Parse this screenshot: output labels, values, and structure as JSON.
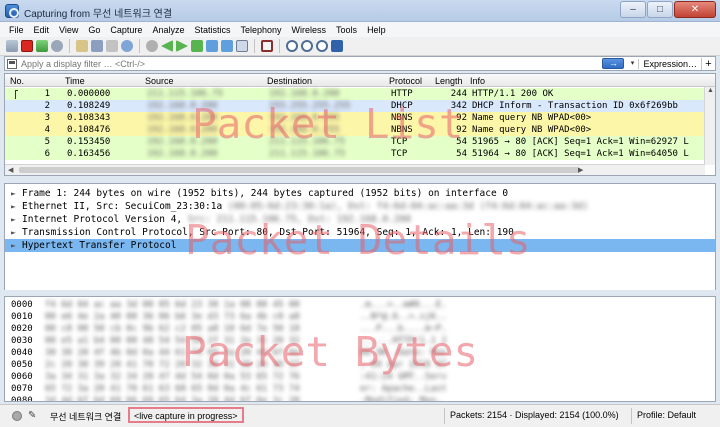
{
  "window": {
    "title": "Capturing from 무선 네트워크 연결",
    "minimize_icon": "minimize-icon",
    "maximize_icon": "maximize-icon",
    "close_icon": "close-icon"
  },
  "menu": [
    "File",
    "Edit",
    "View",
    "Go",
    "Capture",
    "Analyze",
    "Statistics",
    "Telephony",
    "Wireless",
    "Tools",
    "Help"
  ],
  "toolbar": {
    "icons": [
      "shark-fin-start-icon",
      "stop-capture-icon",
      "restart-capture-icon",
      "capture-options-icon",
      "open-file-icon",
      "save-file-icon",
      "close-file-icon",
      "reload-file-icon",
      "find-packet-icon",
      "go-back-icon",
      "go-forward-icon",
      "go-to-packet-icon",
      "go-first-icon",
      "go-last-icon",
      "autoscroll-icon",
      "colorize-icon",
      "zoom-in-icon",
      "zoom-out-icon",
      "zoom-normal-icon",
      "resize-columns-icon"
    ]
  },
  "filter": {
    "placeholder": "Apply a display filter … <Ctrl-/>",
    "arrow_label": "→",
    "dropdown_label": "▾",
    "expression_label": "Expression…",
    "plus_label": "+"
  },
  "packet_list": {
    "columns": [
      "No.",
      "Time",
      "Source",
      "Destination",
      "Protocol",
      "Length",
      "Info"
    ],
    "rows": [
      {
        "no": "1",
        "time": "0.000000",
        "source": "211.115.106.75",
        "destination": "192.168.0.200",
        "protocol": "HTTP",
        "length": "244",
        "info": "HTTP/1.1 200 OK",
        "bg": "#e4ffc7"
      },
      {
        "no": "2",
        "time": "0.108249",
        "source": "192.168.0.200",
        "destination": "255.255.255.255",
        "protocol": "DHCP",
        "length": "342",
        "info": "DHCP Inform   - Transaction ID 0x6f269bb",
        "bg": "#dae8fc"
      },
      {
        "no": "3",
        "time": "0.108343",
        "source": "192.168.0.200",
        "destination": "192.168.0.255",
        "protocol": "NBNS",
        "length": "92",
        "info": "Name query NB WPAD<00>",
        "bg": "#fcf6a8"
      },
      {
        "no": "4",
        "time": "0.108476",
        "source": "192.168.0.200",
        "destination": "192.168.0.255",
        "protocol": "NBNS",
        "length": "92",
        "info": "Name query NB WPAD<00>",
        "bg": "#fcf6a8"
      },
      {
        "no": "5",
        "time": "0.153450",
        "source": "192.168.0.200",
        "destination": "211.115.106.75",
        "protocol": "TCP",
        "length": "54",
        "info": "51965 → 80 [ACK] Seq=1 Ack=1 Win=62927 L",
        "bg": "#e4ffc7"
      },
      {
        "no": "6",
        "time": "0.163456",
        "source": "192.168.0.200",
        "destination": "211.115.106.75",
        "protocol": "TCP",
        "length": "54",
        "info": "51964 → 80 [ACK] Seq=1 Ack=1 Win=64050 L",
        "bg": "#e4ffc7"
      }
    ]
  },
  "packet_details": [
    {
      "text": "Frame 1: 244 bytes on wire (1952 bits), 244 bytes captured (1952 bits) on interface 0",
      "selected": false
    },
    {
      "text": "Ethernet II, Src: SecuiCom_23:30:1a",
      "blurred_tail": "(00:05:6d:23:30:1a), Dst: f4:6d:04:ac:aa:3d (f4:6d:04:ac:aa:3d)",
      "selected": false
    },
    {
      "text": "Internet Protocol Version 4,",
      "blurred_tail": "Src: 211.115.106.75, Dst: 192.168.0.200",
      "selected": false
    },
    {
      "text": "Transmission Control Protocol, Src Port: 80, Dst Port: 51964, Seq: 1, Ack: 1, Len: 190",
      "selected": false
    },
    {
      "text": "Hypertext Transfer Protocol",
      "selected": true
    }
  ],
  "packet_bytes": {
    "offsets": [
      "0000",
      "0010",
      "0020",
      "0030",
      "0040",
      "0050",
      "0060",
      "0070",
      "0080"
    ],
    "hex": [
      "f4 6d 04 ac aa 3d 00 05  6d 23 30 1a 08 00 45 00",
      "00 e6 4e 2a 40 00 36 06  b6 3e d3 73 6a 4b c0 a8",
      "00 c8 00 50 cb 0c 9b 62  c2 05 a8 10 6d 7e 50 18",
      "00 e5 a1 b4 00 00 48 54  54 50 2f 31 2e 31 20 32",
      "30 30 20 4f 4b 0d 0a 44  61 74 65 3a 20 4d 6f 6e",
      "2c 20 30 39 20 41 70 72  20 32 30 31 38 20 30 37",
      "3a 34 31 3a 32 34 20 47  4d 54 0d 0a 53 65 72 76",
      "65 72 3a 20 41 70 61 63  68 65 0d 0a 4c 61 73 74",
      "2d 4d 6f 64 69 66 69 65  64 3a 20 4d 6f 6e 2c 20"
    ],
    "ascii": [
      ".m...=..m#0...E.",
      "..N*@.6..>.sjK..",
      "...P...b....m~P.",
      "......HTTP/1.1 2",
      "00 OK..Date: Mon",
      ", 09 Apr 2018 07",
      ":41:24 GMT..Serv",
      "er: Apache..Last",
      "-Modified: Mon, "
    ]
  },
  "overlays": {
    "list": "Packet List",
    "details": "Packet Details",
    "bytes": "Packet Bytes"
  },
  "status": {
    "interface": "무선 네트워크 연결",
    "live": "<live capture in progress>",
    "packets": "Packets: 2154 · Displayed: 2154 (100.0%)",
    "profile": "Profile: Default",
    "ready_icon": "capture-status-icon",
    "edit_icon": "edit-comment-icon"
  }
}
